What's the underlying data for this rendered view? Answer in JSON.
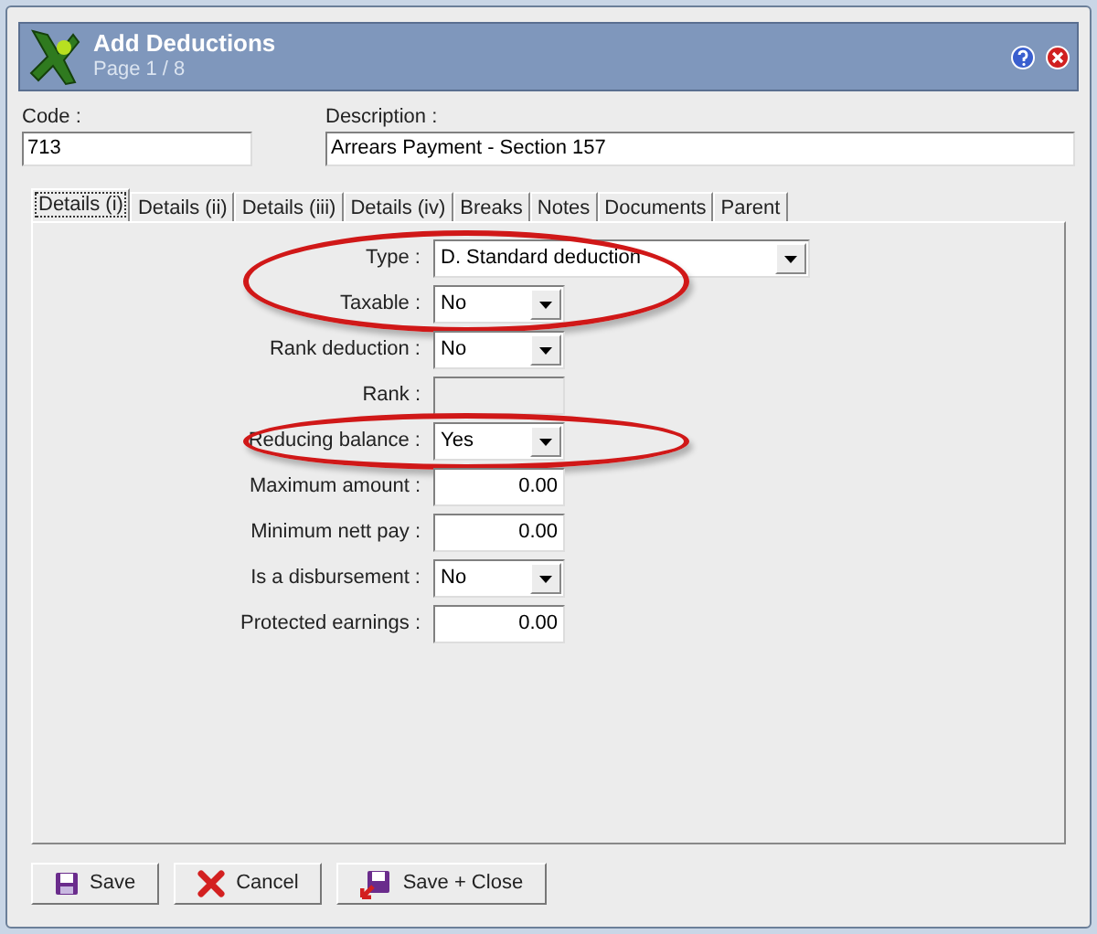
{
  "window": {
    "title": "Add Deductions",
    "subtitle": "Page 1 / 8"
  },
  "header_fields": [
    {
      "label": "Code :",
      "value": "713"
    },
    {
      "label": "Description :",
      "value": "Arrears Payment - Section 157"
    }
  ],
  "tabs": [
    {
      "label": "Details (i)",
      "selected": true
    },
    {
      "label": "Details (ii)",
      "selected": false
    },
    {
      "label": "Details (iii)",
      "selected": false
    },
    {
      "label": "Details (iv)",
      "selected": false
    },
    {
      "label": "Breaks",
      "selected": false
    },
    {
      "label": "Notes",
      "selected": false
    },
    {
      "label": "Documents",
      "selected": false
    },
    {
      "label": "Parent",
      "selected": false
    }
  ],
  "field_groups": [
    {
      "circled": true,
      "fields": [
        {
          "kind": "wide-select",
          "label": "Type :",
          "value": "D. Standard deduction"
        },
        {
          "kind": "select",
          "label": "Taxable :",
          "value": "No"
        }
      ]
    },
    {
      "circled": false,
      "fields": [
        {
          "kind": "select",
          "label": "Rank deduction :",
          "value": "No"
        },
        {
          "kind": "readonly",
          "label": "Rank :"
        }
      ]
    },
    {
      "circled": true,
      "fields": [
        {
          "kind": "select",
          "label": "Reducing balance :",
          "value": "Yes"
        }
      ]
    },
    {
      "circled": false,
      "fields": [
        {
          "kind": "number",
          "label": "Maximum amount :",
          "value": "0.00"
        },
        {
          "kind": "number",
          "label": "Minimum nett pay :",
          "value": "0.00"
        },
        {
          "kind": "select",
          "label": "Is a disbursement :",
          "value": "No"
        },
        {
          "kind": "number",
          "label": "Protected earnings :",
          "value": "0.00"
        }
      ]
    }
  ],
  "buttons": [
    {
      "kind": "save",
      "label": "Save"
    },
    {
      "kind": "cancel",
      "label": "Cancel"
    },
    {
      "kind": "save-close",
      "label": "Save + Close"
    }
  ]
}
